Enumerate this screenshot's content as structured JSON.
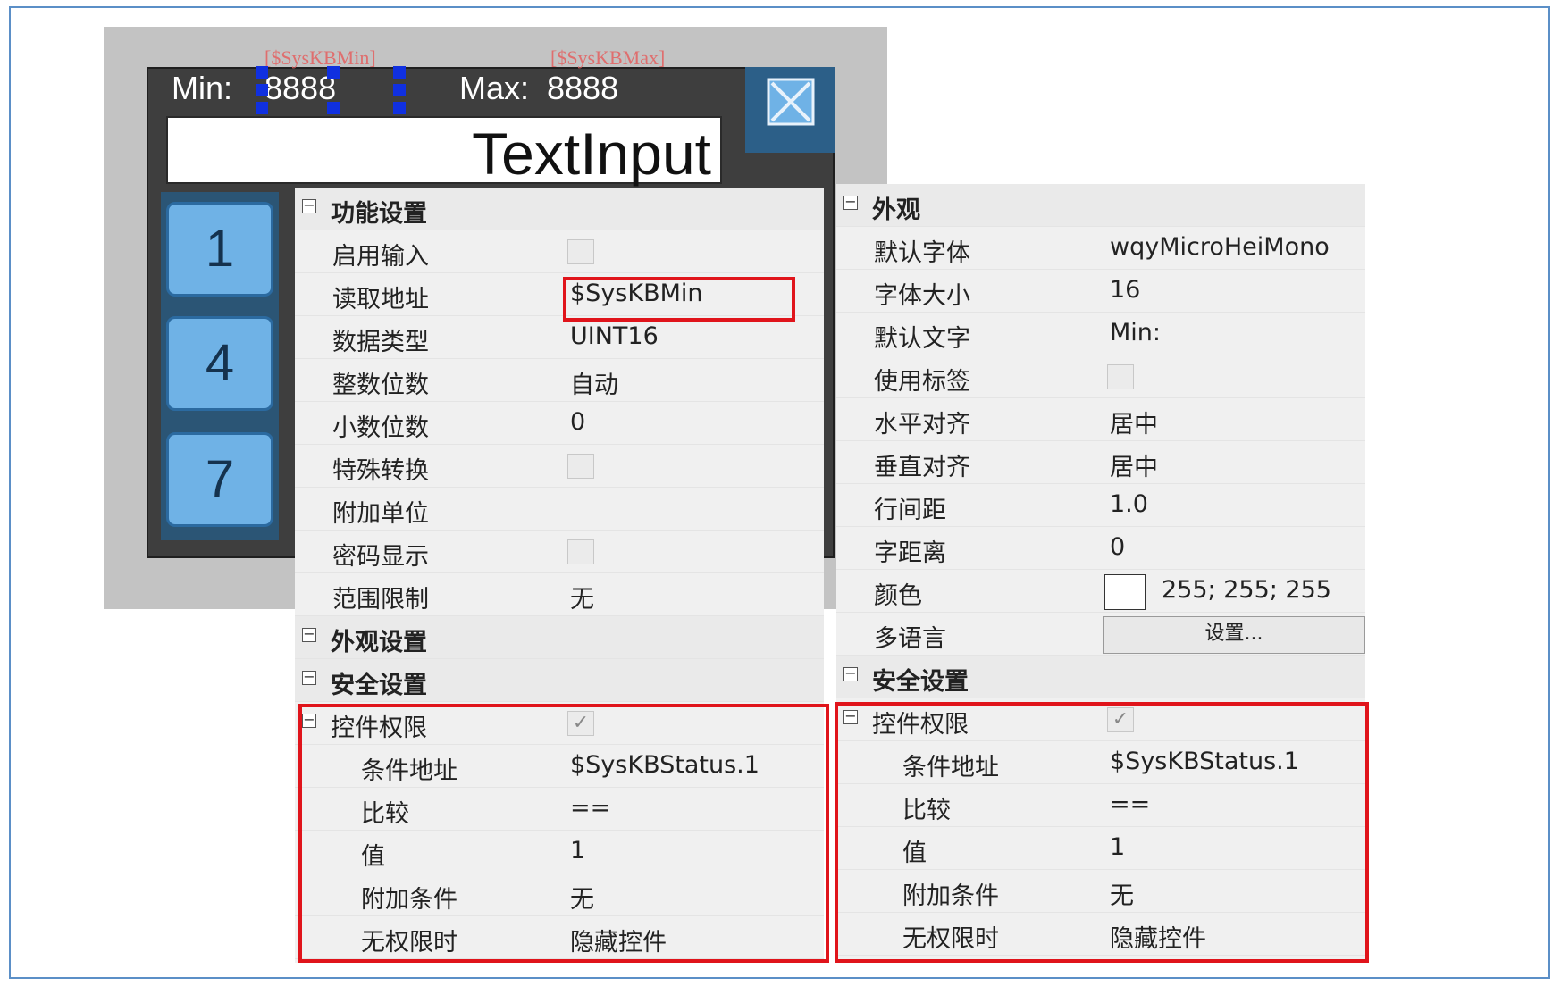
{
  "design": {
    "min_label": "Min:",
    "min_value": "8888",
    "max_label": "Max:",
    "max_value": "8888",
    "tag_min": "[$SysKBMin]",
    "tag_max": "[$SysKBMax]",
    "text_input": "TextInput",
    "keys": [
      "1",
      "4",
      "7"
    ]
  },
  "left_panel": {
    "section_function": "功能设置",
    "rows": [
      {
        "label": "启用输入",
        "value": "",
        "type": "checkbox"
      },
      {
        "label": "读取地址",
        "value": "$SysKBMin",
        "type": "text"
      },
      {
        "label": "数据类型",
        "value": "UINT16",
        "type": "text"
      },
      {
        "label": "整数位数",
        "value": "自动",
        "type": "text"
      },
      {
        "label": "小数位数",
        "value": "0",
        "type": "text"
      },
      {
        "label": "特殊转换",
        "value": "",
        "type": "checkbox"
      },
      {
        "label": "附加单位",
        "value": "",
        "type": "text"
      },
      {
        "label": "密码显示",
        "value": "",
        "type": "checkbox"
      },
      {
        "label": "范围限制",
        "value": "无",
        "type": "text"
      }
    ],
    "section_appearance": "外观设置",
    "section_security": "安全设置",
    "permission": {
      "label": "控件权限",
      "check": "✓",
      "rows": [
        {
          "label": "条件地址",
          "value": "$SysKBStatus.1"
        },
        {
          "label": "比较",
          "value": "=="
        },
        {
          "label": "值",
          "value": "1"
        },
        {
          "label": "附加条件",
          "value": "无"
        },
        {
          "label": "无权限时",
          "value": "隐藏控件"
        }
      ]
    }
  },
  "right_panel": {
    "section_appearance": "外观",
    "rows": [
      {
        "label": "默认字体",
        "value": "wqyMicroHeiMono",
        "type": "text"
      },
      {
        "label": "字体大小",
        "value": "16",
        "type": "text"
      },
      {
        "label": "默认文字",
        "value": "Min:",
        "type": "text"
      },
      {
        "label": "使用标签",
        "value": "",
        "type": "checkbox"
      },
      {
        "label": "水平对齐",
        "value": "居中",
        "type": "text"
      },
      {
        "label": "垂直对齐",
        "value": "居中",
        "type": "text"
      },
      {
        "label": "行间距",
        "value": "1.0",
        "type": "text"
      },
      {
        "label": "字距离",
        "value": "0",
        "type": "text"
      },
      {
        "label": "颜色",
        "value": "255; 255; 255",
        "type": "color"
      },
      {
        "label": "多语言",
        "value": "设置...",
        "type": "button"
      }
    ],
    "section_security": "安全设置",
    "permission": {
      "label": "控件权限",
      "check": "✓",
      "rows": [
        {
          "label": "条件地址",
          "value": "$SysKBStatus.1"
        },
        {
          "label": "比较",
          "value": "=="
        },
        {
          "label": "值",
          "value": "1"
        },
        {
          "label": "附加条件",
          "value": "无"
        },
        {
          "label": "无权限时",
          "value": "隐藏控件"
        }
      ]
    }
  },
  "colors": {
    "highlight": "#e0141b",
    "key_fill": "#6fb2e6",
    "close_bg": "#2c5f88"
  }
}
